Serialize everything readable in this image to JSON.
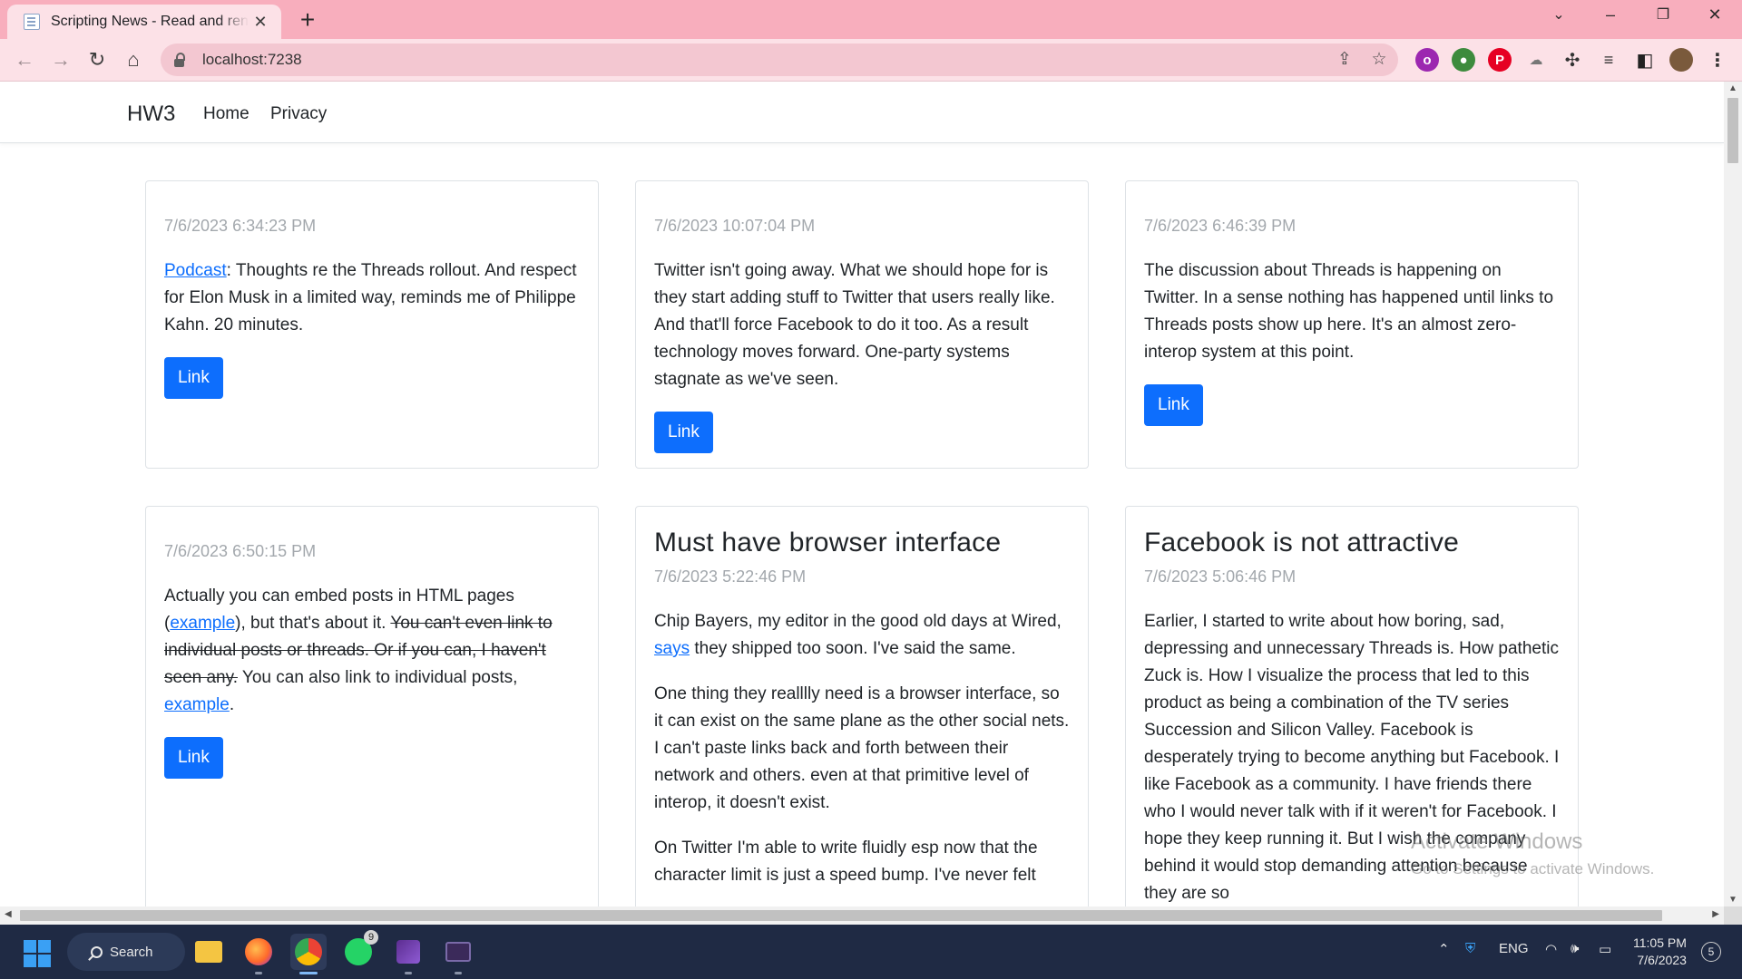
{
  "browser": {
    "tab_title": "Scripting News - Read and render",
    "url": "localhost:7238"
  },
  "site": {
    "brand": "HW3",
    "nav": [
      "Home",
      "Privacy"
    ]
  },
  "cards": {
    "c1": {
      "date": "7/6/2023 6:34:23 PM",
      "p1_link": "Podcast",
      "p1_text": ": Thoughts re the Threads rollout. And respect for Elon Musk in a limited way, reminds me of Philippe Kahn. 20 minutes.",
      "button": "Link"
    },
    "c2": {
      "date": "7/6/2023 10:07:04 PM",
      "text": "Twitter isn't going away. What we should hope for is they start adding stuff to Twitter that users really like. And that'll force Facebook to do it too. As a result technology moves forward. One-party systems stagnate as we've seen.",
      "button": "Link"
    },
    "c3": {
      "date": "7/6/2023 6:46:39 PM",
      "text": "The discussion about Threads is happening on Twitter. In a sense nothing has happened until links to Threads posts show up here. It's an almost zero-interop system at this point.",
      "button": "Link"
    },
    "c4": {
      "date": "7/6/2023 6:50:15 PM",
      "t1": "Actually you can embed posts in HTML pages (",
      "l1": "example",
      "t2": "), but that's about it. ",
      "struck": "You can't even link to individual posts or threads. Or if you can, I haven't seen any.",
      "t3": " You can also link to individual posts, ",
      "l2": "example",
      "t4": ".",
      "button": "Link"
    },
    "c5": {
      "title": "Must have browser interface",
      "date": "7/6/2023 5:22:46 PM",
      "p1a": "Chip Bayers, my editor in the good old days at Wired, ",
      "p1_link": "says",
      "p1b": " they shipped too soon. I've said the same.",
      "p2": "One thing they realllly need is a browser interface, so it can exist on the same plane as the other social nets. I can't paste links back and forth between their network and others. even at that primitive level of interop, it doesn't exist.",
      "p3": "On Twitter I'm able to write fluidly esp now that the character limit is just a speed bump. I've never felt"
    },
    "c6": {
      "title": "Facebook is not attractive",
      "date": "7/6/2023 5:06:46 PM",
      "text": "Earlier, I started to write about how boring, sad, depressing and unnecessary Threads is. How pathetic Zuck is. How I visualize the process that led to this product as being a combination of the TV series Succession and Silicon Valley. Facebook is desperately trying to become anything but Facebook. I like Facebook as a community. I have friends there who I would never talk with if it weren't for Facebook. I hope they keep running it. But I wish the company behind it would stop demanding attention because they are so"
    }
  },
  "watermark": {
    "line1": "Activate Windows",
    "line2": "Go to Settings to activate Windows."
  },
  "taskbar": {
    "search": "Search",
    "whatsapp_badge": "9",
    "lang": "ENG",
    "time": "11:05 PM",
    "date": "7/6/2023",
    "notifications": "5"
  },
  "colors": {
    "tab_strip": "#f8aebd",
    "toolbar": "#fce1e7",
    "primary": "#0d6efd",
    "taskbar": "#1f2a44"
  }
}
